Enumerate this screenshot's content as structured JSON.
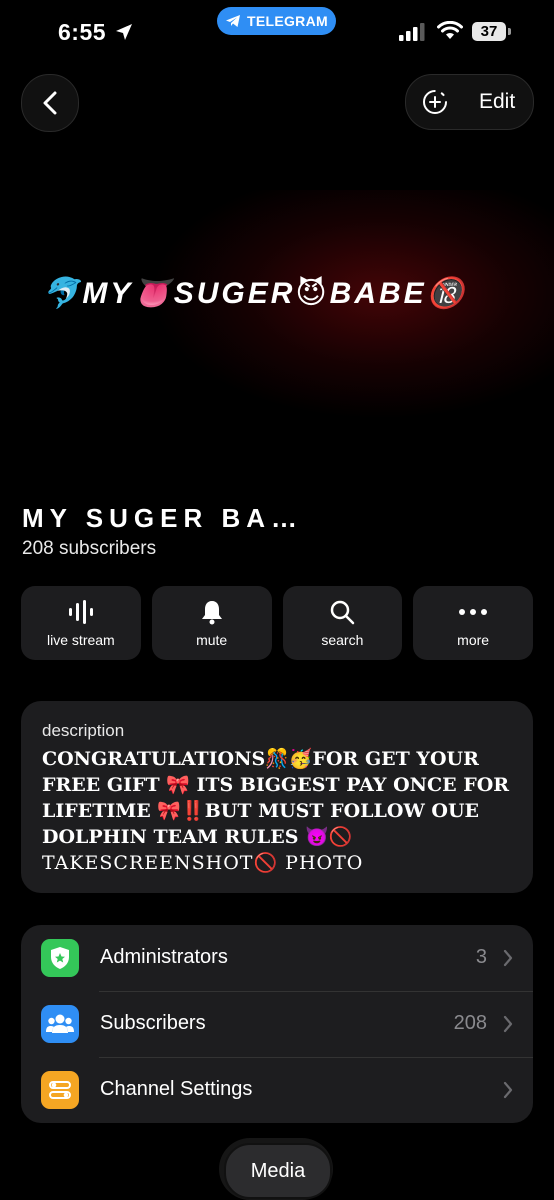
{
  "status_bar": {
    "time": "6:55",
    "telegram_label": "TELEGRAM",
    "battery": "37"
  },
  "nav": {
    "edit_label": "Edit"
  },
  "banner": {
    "text": "🐬MY👅SUGER😈BABE🔞"
  },
  "channel": {
    "title": "MY SUGER BA…",
    "subscribers_line": "208 subscribers"
  },
  "actions": [
    {
      "label": "live stream",
      "icon": "live-stream-icon"
    },
    {
      "label": "mute",
      "icon": "bell-icon"
    },
    {
      "label": "search",
      "icon": "search-icon"
    },
    {
      "label": "more",
      "icon": "more-icon"
    }
  ],
  "description": {
    "heading": "description",
    "body": "CONGRATULATIONS🎊🥳FOR GET YOUR FREE GIFT 🎀 ITS BIGGEST PAY ONCE FOR LIFETIME 🎀‼️BUT MUST FOLLOW OUE DOLPHIN TEAM RULES 😈🚫",
    "body_outline": "TAKESCREENSHOT🚫 PHOTO"
  },
  "info_rows": [
    {
      "label": "Administrators",
      "value": "3",
      "icon": "shield-star-icon",
      "color": "#34c759"
    },
    {
      "label": "Subscribers",
      "value": "208",
      "icon": "people-icon",
      "color": "#2f8ef4"
    },
    {
      "label": "Channel Settings",
      "value": "",
      "icon": "settings-toggles-icon",
      "color": "#f5a623"
    }
  ],
  "tabs": {
    "media_label": "Media"
  },
  "colors": {
    "accent_blue": "#2f8ef4",
    "card_bg": "#1d1d1f",
    "secondary_text": "#8a8a8e"
  }
}
